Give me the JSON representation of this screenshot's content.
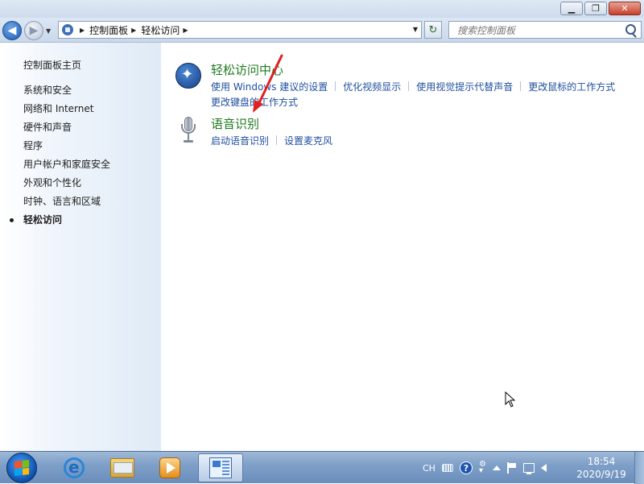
{
  "titlebar": {
    "minimize_glyph": "▁",
    "maximize_glyph": "❐",
    "close_glyph": "✕"
  },
  "navbar": {
    "back_glyph": "◀",
    "forward_glyph": "▶",
    "breadcrumb": [
      "控制面板",
      "轻松访问"
    ],
    "search_placeholder": "搜索控制面板",
    "refresh_glyph": "↻"
  },
  "sidebar": {
    "home": "控制面板主页",
    "items": [
      {
        "label": "系统和安全"
      },
      {
        "label": "网络和 Internet"
      },
      {
        "label": "硬件和声音"
      },
      {
        "label": "程序"
      },
      {
        "label": "用户帐户和家庭安全"
      },
      {
        "label": "外观和个性化"
      },
      {
        "label": "时钟、语言和区域"
      },
      {
        "label": "轻松访问",
        "active": true
      }
    ]
  },
  "content": {
    "groups": [
      {
        "title": "轻松访问中心",
        "icon": "ease-of-access-icon",
        "links": [
          "使用 Windows 建议的设置",
          "优化视频显示",
          "使用视觉提示代替声音",
          "更改鼠标的工作方式",
          "更改键盘的工作方式"
        ]
      },
      {
        "title": "语音识别",
        "icon": "microphone-icon",
        "links": [
          "启动语音识别",
          "设置麦克风"
        ]
      }
    ]
  },
  "annotation": {
    "color": "#e02020"
  },
  "taskbar": {
    "pinned": [
      "start-button",
      "internet-explorer-icon",
      "windows-explorer-icon",
      "media-player-icon",
      "control-panel-icon"
    ],
    "tray": {
      "language": "CH"
    },
    "clock": {
      "time": "18:54",
      "date": "2020/9/19"
    }
  },
  "colors": {
    "link": "#1f4fa0",
    "group_title": "#1f7a1f",
    "taskbar": "#7fa0c8"
  }
}
